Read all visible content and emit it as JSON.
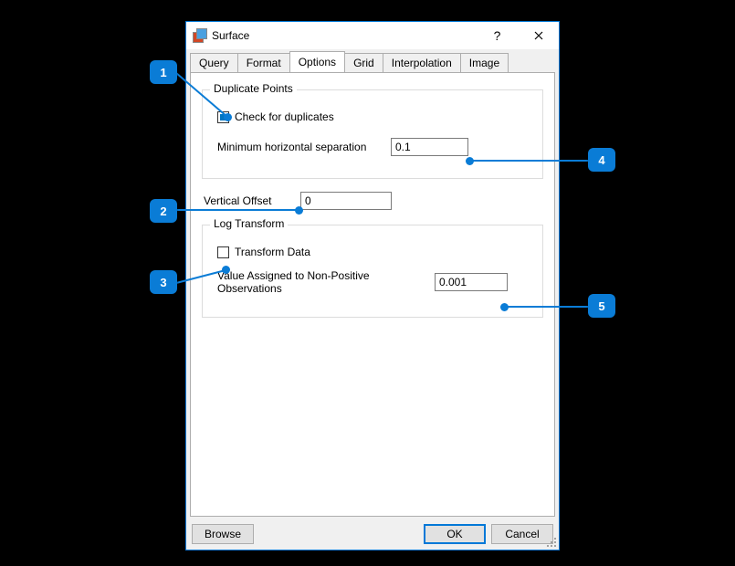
{
  "dialog": {
    "title": "Surface",
    "help_tooltip": "?",
    "close_tooltip": "Close"
  },
  "tabs": {
    "query": "Query",
    "format": "Format",
    "options": "Options",
    "grid": "Grid",
    "interpolation": "Interpolation",
    "image": "Image"
  },
  "options": {
    "duplicate_points": {
      "legend": "Duplicate Points",
      "check_label": "Check for duplicates",
      "checked": true,
      "min_sep_label": "Minimum horizontal separation",
      "min_sep_value": "0.1"
    },
    "vertical_offset": {
      "label": "Vertical Offset",
      "value": "0"
    },
    "log_transform": {
      "legend": "Log Transform",
      "transform_label": "Transform Data",
      "transform_checked": false,
      "nonpos_label": "Value Assigned to Non-Positive Observations",
      "nonpos_value": "0.001"
    }
  },
  "buttons": {
    "browse": "Browse",
    "ok": "OK",
    "cancel": "Cancel"
  },
  "callouts": {
    "1": "1",
    "2": "2",
    "3": "3",
    "4": "4",
    "5": "5"
  }
}
